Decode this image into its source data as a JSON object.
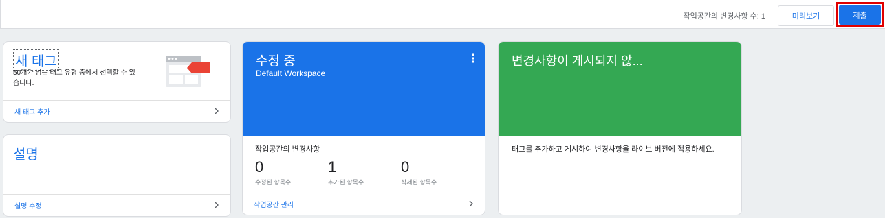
{
  "topbar": {
    "change_count": "작업공간의 변경사항 수: 1",
    "preview_label": "미리보기",
    "submit_label": "제출",
    "highlight_color": "#e00000"
  },
  "new_tag_card": {
    "title": "새 태그",
    "description": "50개가 넘는 태그 유형 중에서 선택할 수 있습니다.",
    "footer_link": "새 태그 추가"
  },
  "description_card": {
    "title": "설명",
    "footer_link": "설명 수정"
  },
  "editing_card": {
    "title": "수정 중",
    "subtitle": "Default Workspace",
    "header_color": "#1a73e8",
    "changes_title": "작업공간의 변경사항",
    "stats": [
      {
        "value": "0",
        "label": "수정된 항목수"
      },
      {
        "value": "1",
        "label": "추가된 항목수"
      },
      {
        "value": "0",
        "label": "삭제된 항목수"
      }
    ],
    "footer_link": "작업공간 관리"
  },
  "publish_card": {
    "title": "변경사항이 게시되지 않...",
    "header_color": "#34a853",
    "description": "태그를 추가하고 게시하여 변경사항을 라이브 버전에 적용하세요."
  }
}
